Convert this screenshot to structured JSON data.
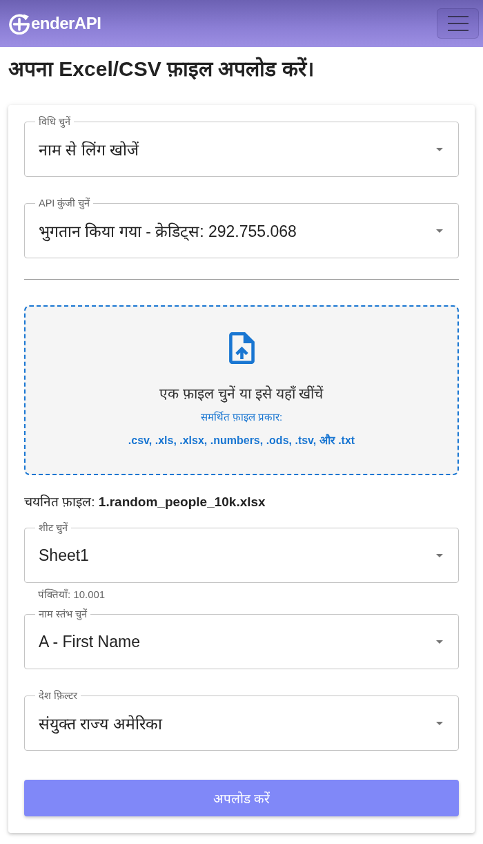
{
  "header": {
    "logo": "enderAPI"
  },
  "page_title": "अपना Excel/CSV फ़ाइल अपलोड करें।",
  "form": {
    "items": [
      {
        "kind": "select",
        "label": "विधि चुनें",
        "value": "नाम से लिंग खोजें"
      },
      {
        "kind": "select",
        "label": "API कुंजी चुनें",
        "value": "भुगतान किया गया - क्रेडिट्स: 292.755.068"
      },
      {
        "kind": "divider"
      },
      {
        "kind": "dropzone",
        "prompt": "एक फ़ाइल चुनें या इसे यहाँ खींचें",
        "types_label": "समर्थित फ़ाइल प्रकार:",
        "types": ".csv, .xls, .xlsx, .numbers, .ods, .tsv, और .txt"
      },
      {
        "kind": "file",
        "text": "चयनित फ़ाइल: **1.random_people_10k.xlsx**"
      },
      {
        "kind": "select",
        "label": "शीट चुनें",
        "value": "Sheet1",
        "helper": "पंक्तियाँ: 10.001"
      },
      {
        "kind": "select",
        "label": "नाम स्तंभ चुनें",
        "value": "A - First Name"
      },
      {
        "kind": "select",
        "label": "देश फ़िल्टर",
        "value": "संयुक्त राज्य अमेरिका"
      },
      {
        "kind": "button",
        "label": "अपलोड करें"
      }
    ]
  }
}
